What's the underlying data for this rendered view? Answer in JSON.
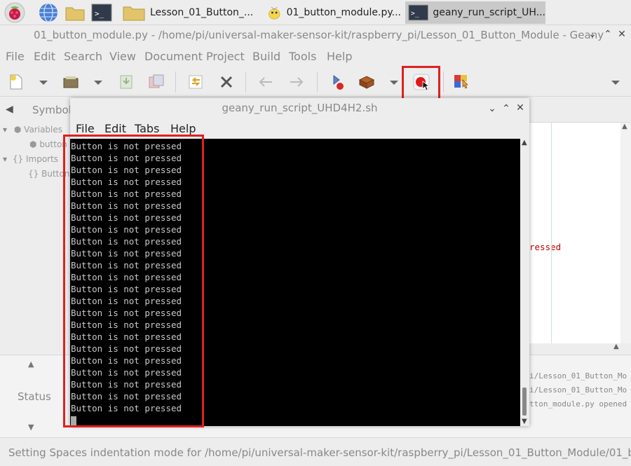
{
  "taskbar": {
    "tasks": [
      {
        "label": "Lesson_01_Button_..."
      },
      {
        "label": "01_button_module.py..."
      },
      {
        "label": "geany_run_script_UH..."
      }
    ]
  },
  "geany": {
    "title": "01_button_module.py - /home/pi/universal-maker-sensor-kit/raspberry_pi/Lesson_01_Button_Module - Geany",
    "menu": [
      "File",
      "Edit",
      "Search",
      "View",
      "Document",
      "Project",
      "Build",
      "Tools",
      "Help"
    ],
    "sidebar": {
      "tab": "Symbol",
      "tree": [
        {
          "label": "Variables"
        },
        {
          "label": "button"
        },
        {
          "label": "Imports"
        },
        {
          "label": "Button"
        }
      ]
    },
    "editor_fragment": "ressed",
    "messages": {
      "label": "Status",
      "lines": [
        "i/Lesson_01_Button_Mo",
        "i/Lesson_01_Button_Mo",
        "tton_module.py opened"
      ]
    },
    "statusbar": "Setting Spaces indentation mode for /home/pi/universal-maker-sensor-kit/raspberry_pi/Lesson_01_Button_Module/01_but..."
  },
  "terminal": {
    "title": "geany_run_script_UHD4H2.sh",
    "menu": [
      "File",
      "Edit",
      "Tabs",
      "Help"
    ],
    "lines": [
      "Button is not pressed",
      "Button is not pressed",
      "Button is not pressed",
      "Button is not pressed",
      "Button is not pressed",
      "Button is not pressed",
      "Button is not pressed",
      "Button is not pressed",
      "Button is not pressed",
      "Button is not pressed",
      "Button is not pressed",
      "Button is not pressed",
      "Button is not pressed",
      "Button is not pressed",
      "Button is not pressed",
      "Button is not pressed",
      "Button is not pressed",
      "Button is not pressed",
      "Button is not pressed",
      "Button is not pressed",
      "Button is not pressed",
      "Button is not pressed",
      "Button is not pressed"
    ]
  },
  "colors": {
    "highlight_red": "#e02020",
    "terminal_bg": "#000000",
    "terminal_fg": "#c8c8c8"
  }
}
